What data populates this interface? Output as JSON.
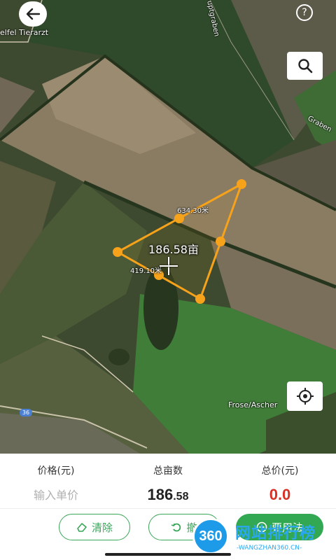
{
  "map": {
    "place_label_1": "elfel Tierarzt",
    "place_label_2": "Frose/Ascher",
    "road_label_graben": "Graben",
    "road_label_haupt": "uptgraben",
    "road_number": "36",
    "area_label": "186.58亩",
    "edge_label_1": "634.30米",
    "edge_label_2": "419.10米",
    "help_glyph": "?",
    "polygon_color": "#f7a21b",
    "icons": [
      "arrow-left-icon",
      "help-icon",
      "search-icon",
      "locate-icon",
      "crosshair-icon"
    ]
  },
  "stats": {
    "price_header": "价格(元)",
    "area_header": "总亩数",
    "total_header": "总价(元)",
    "price_placeholder": "输入单价",
    "area_int": "186",
    "area_frac": ".58",
    "total_value": "0.0",
    "total_color": "#d93025"
  },
  "actions": {
    "clear_label": "清除",
    "undo_label": "撤",
    "use_label": "要用法",
    "accent_color": "#33a853"
  },
  "watermark": {
    "badge": "360",
    "title": "网站排行榜",
    "subtitle": "-WANGZHAN360.CN-"
  }
}
